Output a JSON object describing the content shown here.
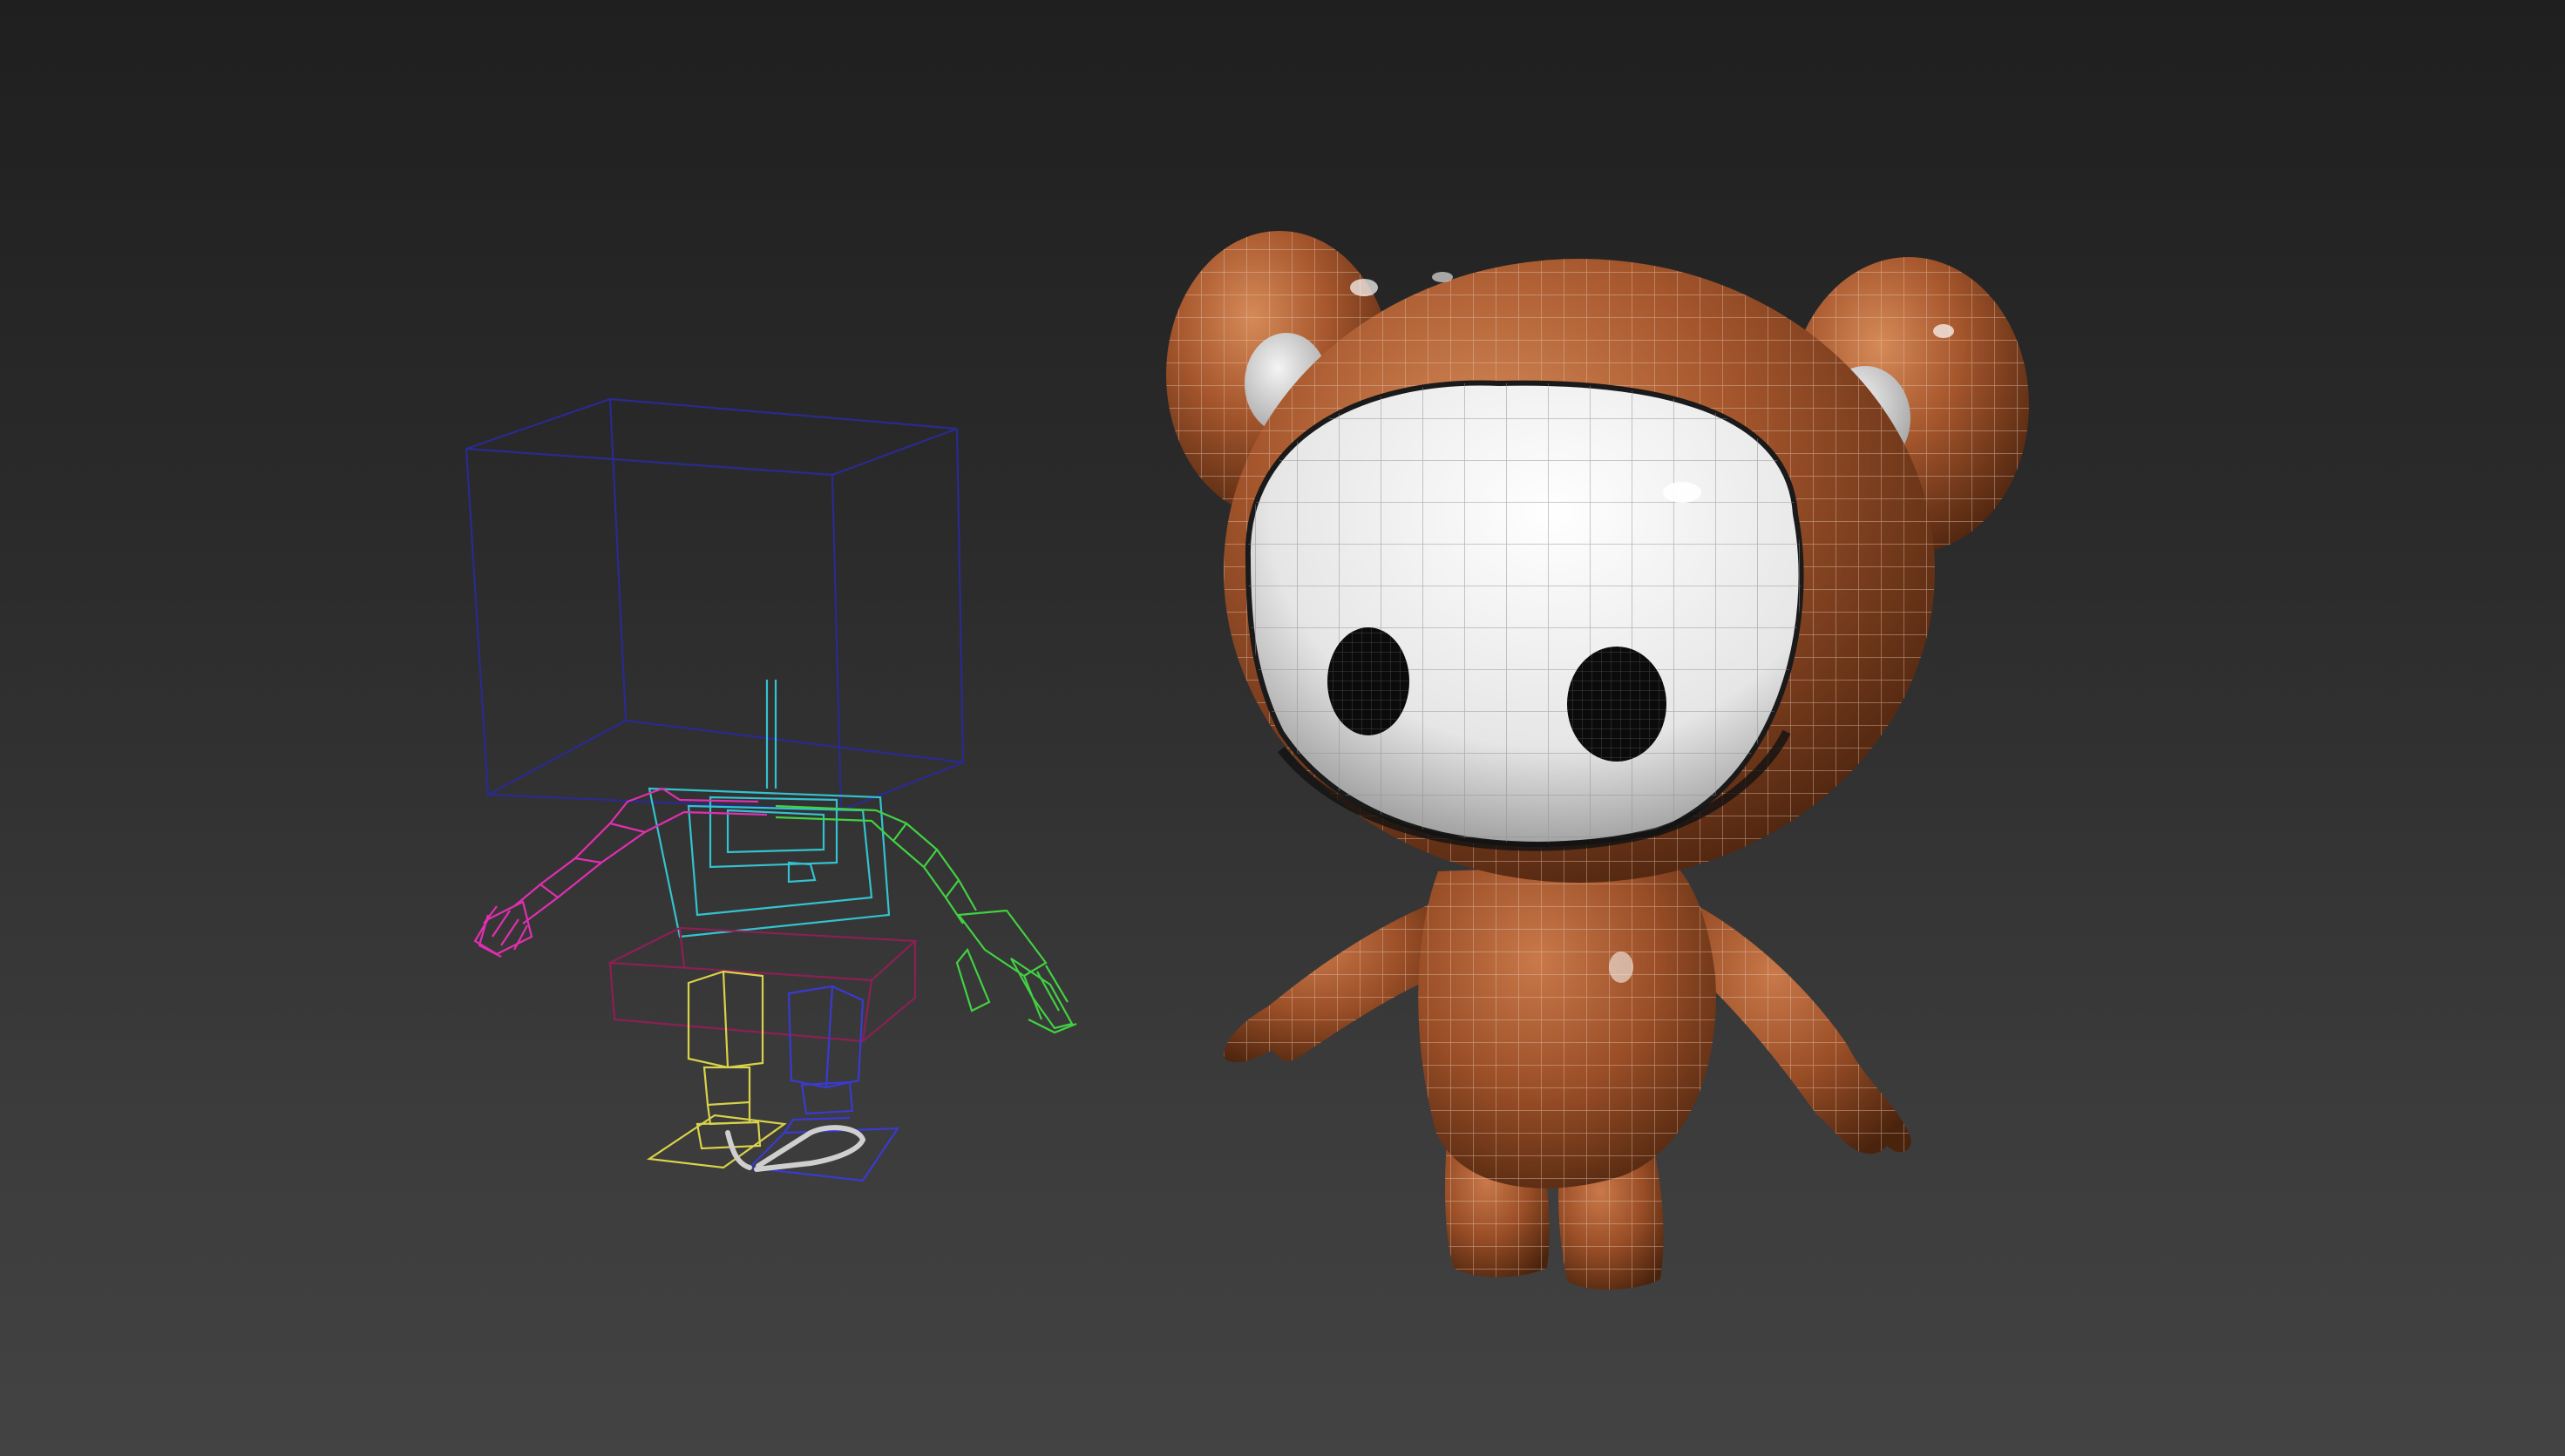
{
  "viewport": {
    "background_top": "#1f1f1f",
    "background_bottom": "#434343"
  },
  "scene": {
    "objects": [
      {
        "id": "rig",
        "kind": "bone-rig-wireframe"
      },
      {
        "id": "bear-character",
        "kind": "shaded-mesh-with-wireframe"
      }
    ]
  },
  "colors": {
    "bear_body": "#a5562c",
    "bear_body_light": "#c9794a",
    "bear_body_dark": "#5c2e14",
    "face_white": "#f2f2f2",
    "eye_black": "#0b0b0b",
    "wire_on_mesh": "#d8d8d8",
    "rig_head_box": "#27278a",
    "rig_left_arm": "#e02fb0",
    "rig_right_arm": "#42d142",
    "rig_spine": "#33c3cf",
    "rig_pelvis": "#8c1f55",
    "rig_left_leg": "#d9d24a",
    "rig_right_leg": "#3a3ad0",
    "rig_foot_curve": "#d0d0d0"
  }
}
